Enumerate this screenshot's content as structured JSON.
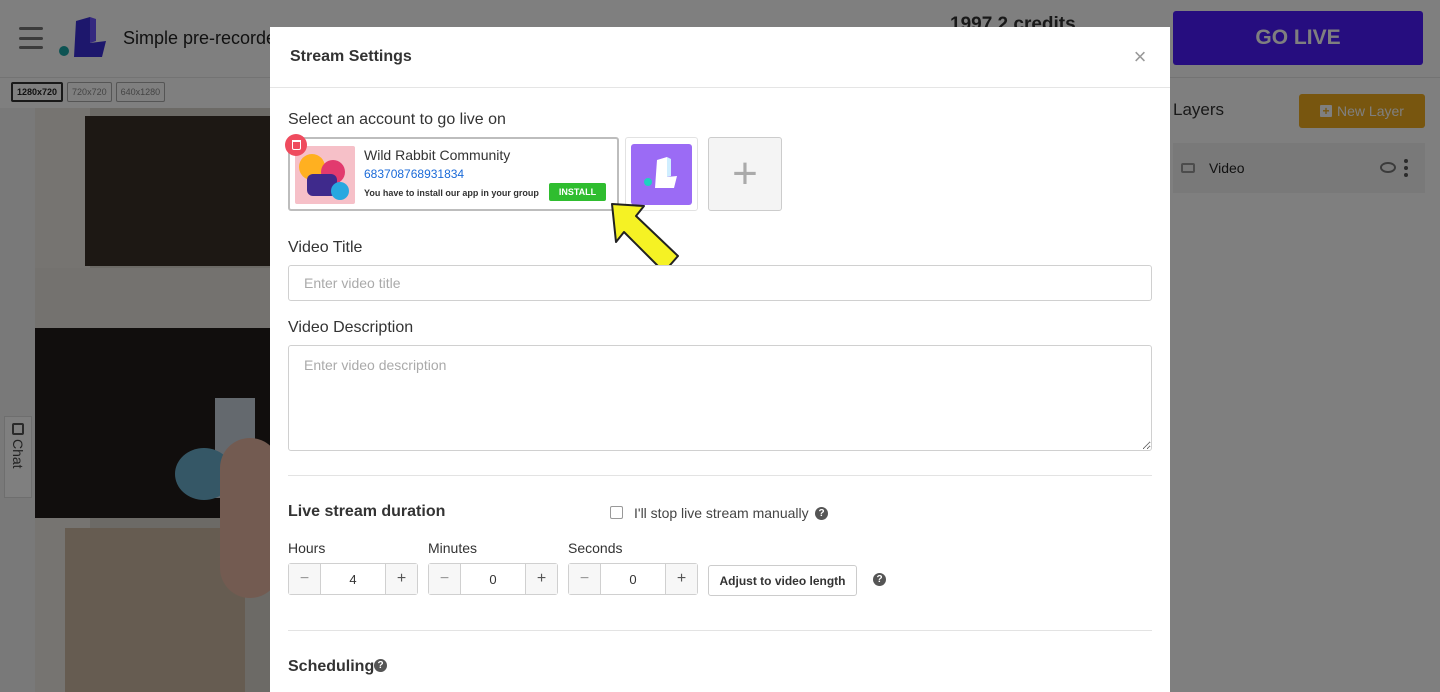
{
  "app": {
    "project_title": "Simple pre-recorded",
    "credits": "1997.2 credits",
    "go_live_label": "GO LIVE",
    "resolutions": [
      "1280x720",
      "720x720",
      "640x1280"
    ],
    "chat_label": "Chat",
    "layers_title": "Layers",
    "new_layer_label": "New Layer",
    "layers": [
      {
        "name": "Video",
        "icon": "video-camera-icon"
      }
    ]
  },
  "modal": {
    "title": "Stream Settings",
    "close_glyph": "×",
    "account_section_label": "Select an account to go live on",
    "accounts": [
      {
        "name": "Wild Rabbit Community",
        "id": "683708768931834",
        "note": "You have to install our app in your group",
        "install_label": "INSTALL"
      }
    ],
    "add_account_glyph": "+",
    "video_title": {
      "label": "Video Title",
      "placeholder": "Enter video title",
      "value": ""
    },
    "video_description": {
      "label": "Video Description",
      "placeholder": "Enter video description",
      "value": ""
    },
    "duration": {
      "label": "Live stream duration",
      "manual_stop_label": "I'll stop live stream manually",
      "manual_stop_checked": false,
      "hours": {
        "label": "Hours",
        "value": "4"
      },
      "minutes": {
        "label": "Minutes",
        "value": "0"
      },
      "seconds": {
        "label": "Seconds",
        "value": "0"
      },
      "adjust_label": "Adjust to video length"
    },
    "scheduling_label": "Scheduling",
    "help_glyph": "?"
  },
  "colors": {
    "go_live": "#4d1bff",
    "new_layer": "#f0ad1e",
    "install": "#2fbd2f",
    "delete_badge": "#ef4b5e",
    "account_link": "#1a6ad8",
    "brand_purple": "#9b6bf5",
    "callout_arrow": "#f5f224"
  }
}
